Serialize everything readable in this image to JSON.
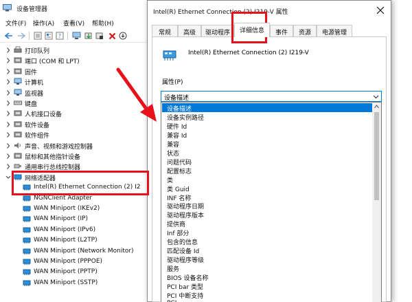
{
  "device_manager": {
    "title": "设备管理器",
    "menu": [
      "文件(F)",
      "操作(A)",
      "查看(V)",
      "帮助(H)"
    ],
    "tree": [
      {
        "label": "打印队列",
        "icon": "printer-icon",
        "indent": 1,
        "chevron": "right"
      },
      {
        "label": "端口 (COM 和 LPT)",
        "icon": "port-icon",
        "indent": 1,
        "chevron": "right"
      },
      {
        "label": "固件",
        "icon": "firmware-icon",
        "indent": 1,
        "chevron": "right"
      },
      {
        "label": "计算机",
        "icon": "computer-icon",
        "indent": 1,
        "chevron": "right"
      },
      {
        "label": "监视器",
        "icon": "monitor-icon",
        "indent": 1,
        "chevron": "right"
      },
      {
        "label": "键盘",
        "icon": "keyboard-icon",
        "indent": 1,
        "chevron": "right"
      },
      {
        "label": "人机接口设备",
        "icon": "hid-icon",
        "indent": 1,
        "chevron": "right"
      },
      {
        "label": "软件设备",
        "icon": "software-device-icon",
        "indent": 1,
        "chevron": "right"
      },
      {
        "label": "软件组件",
        "icon": "software-component-icon",
        "indent": 1,
        "chevron": "right"
      },
      {
        "label": "声音、视频和游戏控制器",
        "icon": "sound-icon",
        "indent": 1,
        "chevron": "right"
      },
      {
        "label": "鼠标和其他指针设备",
        "icon": "mouse-icon",
        "indent": 1,
        "chevron": "right"
      },
      {
        "label": "通用串行总线控制器",
        "icon": "usb-icon",
        "indent": 1,
        "chevron": "right"
      },
      {
        "label": "网络适配器",
        "icon": "network-adapter-icon",
        "indent": 1,
        "chevron": "down"
      },
      {
        "label": "Intel(R) Ethernet Connection (2) I2",
        "icon": "network-card-icon",
        "indent": 2,
        "chevron": ""
      },
      {
        "label": "NGNClient Adapter",
        "icon": "network-card-icon",
        "indent": 2,
        "chevron": ""
      },
      {
        "label": "WAN Miniport (IKEv2)",
        "icon": "network-card-icon",
        "indent": 2,
        "chevron": ""
      },
      {
        "label": "WAN Miniport (IP)",
        "icon": "network-card-icon",
        "indent": 2,
        "chevron": ""
      },
      {
        "label": "WAN Miniport (IPv6)",
        "icon": "network-card-icon",
        "indent": 2,
        "chevron": ""
      },
      {
        "label": "WAN Miniport (L2TP)",
        "icon": "network-card-icon",
        "indent": 2,
        "chevron": ""
      },
      {
        "label": "WAN Miniport (Network Monitor)",
        "icon": "network-card-icon",
        "indent": 2,
        "chevron": ""
      },
      {
        "label": "WAN Miniport (PPPOE)",
        "icon": "network-card-icon",
        "indent": 2,
        "chevron": ""
      },
      {
        "label": "WAN Miniport (PPTP)",
        "icon": "network-card-icon",
        "indent": 2,
        "chevron": ""
      },
      {
        "label": "WAN Miniport (SSTP)",
        "icon": "network-card-icon",
        "indent": 2,
        "chevron": ""
      }
    ]
  },
  "dialog": {
    "title": "Intel(R) Ethernet Connection (2) I219-V 属性",
    "tabs": [
      "常规",
      "高级",
      "驱动程序",
      "详细信息",
      "事件",
      "资源",
      "电源管理"
    ],
    "active_tab": "详细信息",
    "device_name": "Intel(R) Ethernet Connection (2) I219-V",
    "property_label": "属性(P)",
    "selected_property": "设备描述",
    "options": [
      "设备描述",
      "设备实例路径",
      "硬件 Id",
      "兼容 Id",
      "兼容",
      "状态",
      "问题代码",
      "配置标志",
      "类",
      "类 Guid",
      "INF 名称",
      "驱动程序日期",
      "驱动程序版本",
      "提供商",
      "Inf 部分",
      "包含的信息",
      "匹配设备 Id",
      "驱动程序等级",
      "服务",
      "BIOS 设备名称",
      "PCI bar 类型",
      "PCI 中断支持",
      "PCI ..."
    ]
  },
  "colors": {
    "accent": "#0078d7",
    "annotation_red": "#e8101a",
    "network_icon": "#2a8fd8"
  }
}
